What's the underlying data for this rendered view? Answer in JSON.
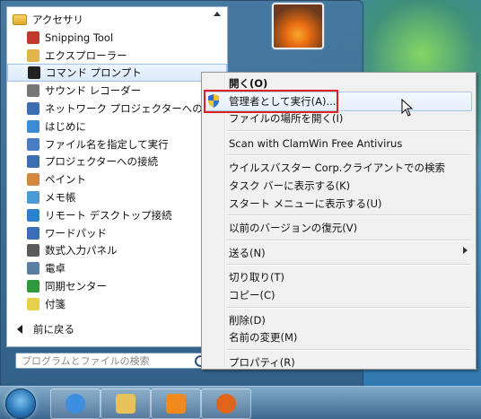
{
  "start_menu": {
    "programs": [
      {
        "label": "アクセサリ",
        "icon": "folder-icon",
        "type": "folder"
      },
      {
        "label": "Snipping Tool",
        "icon": "scissors-icon"
      },
      {
        "label": "エクスプローラー",
        "icon": "explorer-icon"
      },
      {
        "label": "コマンド プロンプト",
        "icon": "cmd-icon",
        "selected": true
      },
      {
        "label": "サウンド レコーダー",
        "icon": "microphone-icon"
      },
      {
        "label": "ネットワーク プロジェクターへの接",
        "icon": "network-projector-icon"
      },
      {
        "label": "はじめに",
        "icon": "getting-started-icon"
      },
      {
        "label": "ファイル名を指定して実行",
        "icon": "run-icon"
      },
      {
        "label": "プロジェクターへの接続",
        "icon": "projector-icon"
      },
      {
        "label": "ペイント",
        "icon": "paint-icon"
      },
      {
        "label": "メモ帳",
        "icon": "notepad-icon"
      },
      {
        "label": "リモート デスクトップ接続",
        "icon": "remote-desktop-icon"
      },
      {
        "label": "ワードパッド",
        "icon": "wordpad-icon"
      },
      {
        "label": "数式入力パネル",
        "icon": "math-input-icon"
      },
      {
        "label": "電卓",
        "icon": "calculator-icon"
      },
      {
        "label": "同期センター",
        "icon": "sync-center-icon"
      },
      {
        "label": "付箋",
        "icon": "sticky-notes-icon"
      }
    ],
    "back_label": "前に戻る",
    "search_placeholder": "プログラムとファイルの検索"
  },
  "context_menu": {
    "items": [
      {
        "label": "開く(O)",
        "bold": true
      },
      {
        "label": "管理者として実行(A)...",
        "shield": true,
        "highlighted": true
      },
      {
        "label": "ファイルの場所を開く(I)"
      },
      {
        "separator": true
      },
      {
        "label": "Scan with ClamWin Free Antivirus"
      },
      {
        "separator": true
      },
      {
        "label": "ウイルスバスター Corp.クライアントでの検索"
      },
      {
        "label": "タスク バーに表示する(K)"
      },
      {
        "label": "スタート メニューに表示する(U)"
      },
      {
        "separator": true
      },
      {
        "label": "以前のバージョンの復元(V)"
      },
      {
        "separator": true
      },
      {
        "label": "送る(N)",
        "submenu": true
      },
      {
        "separator": true
      },
      {
        "label": "切り取り(T)"
      },
      {
        "label": "コピー(C)"
      },
      {
        "separator": true
      },
      {
        "label": "削除(D)"
      },
      {
        "label": "名前の変更(M)"
      },
      {
        "separator": true
      },
      {
        "label": "プロパティ(R)"
      }
    ]
  },
  "taskbar": {
    "buttons": [
      {
        "name": "internet-explorer-icon",
        "color": "#3d8de0"
      },
      {
        "name": "file-explorer-icon",
        "color": "#e7c25a"
      },
      {
        "name": "media-player-icon",
        "color": "#f08a1e"
      },
      {
        "name": "firefox-icon",
        "color": "#e0651b"
      }
    ]
  },
  "colors": {
    "highlight_border": "#e02020",
    "selection_border": "#9ec3ea"
  }
}
